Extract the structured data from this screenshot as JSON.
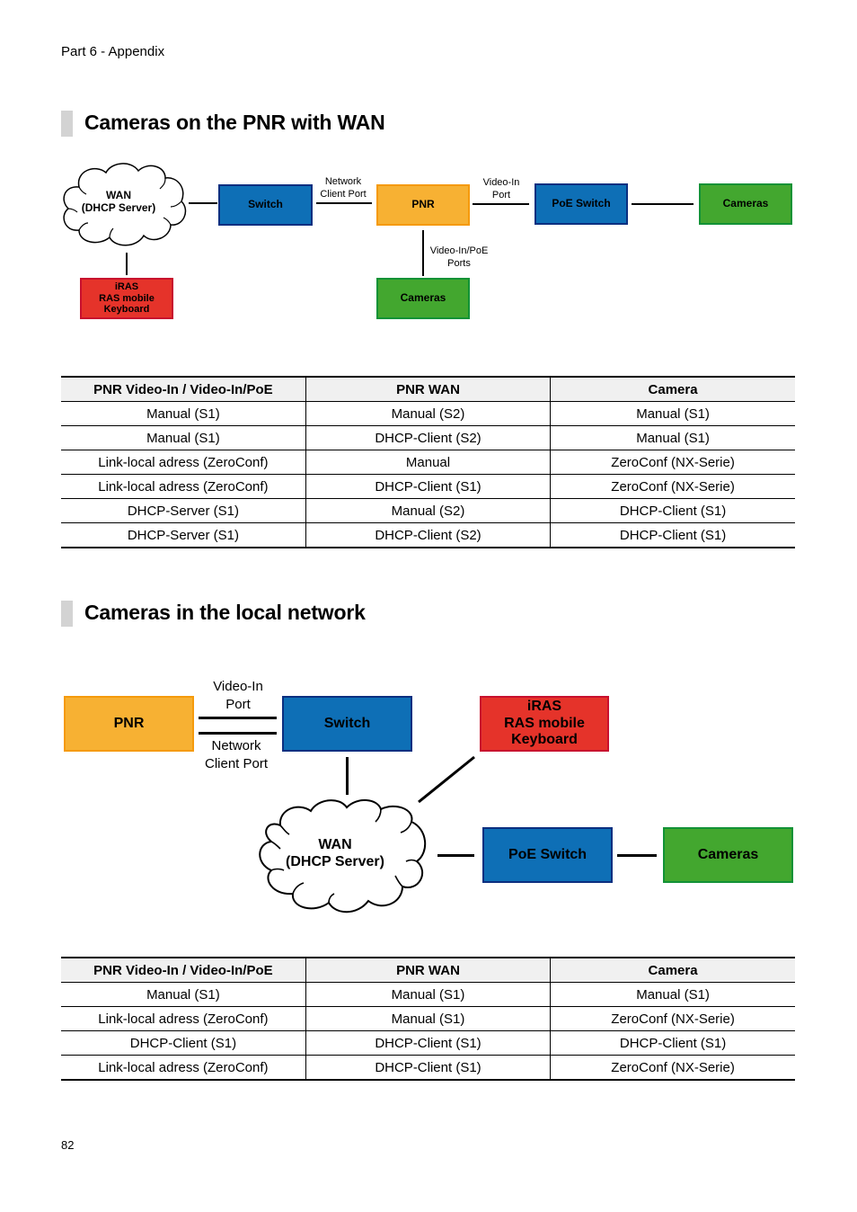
{
  "page": {
    "header": "Part 6 - Appendix",
    "page_number": "82"
  },
  "section1": {
    "title": "Cameras on the PNR with WAN",
    "diagram": {
      "wan_cloud": "WAN\n(DHCP Server)",
      "switch": "Switch",
      "pnr": "PNR",
      "poe_switch": "PoE Switch",
      "cameras_right": "Cameras",
      "cameras_bottom": "Cameras",
      "keyboard": "iRAS\nRAS mobile\nKeyboard",
      "label_network_client_port": "Network\nClient Port",
      "label_video_in_port": "Video-In\nPort",
      "label_video_in_poe_ports": "Video-In/PoE\nPorts"
    },
    "table": {
      "headers": [
        "PNR  Video-In / Video-In/PoE",
        "PNR WAN",
        "Camera"
      ],
      "rows": [
        [
          "Manual (S1)",
          "Manual (S2)",
          "Manual (S1)"
        ],
        [
          "Manual (S1)",
          "DHCP-Client (S2)",
          "Manual (S1)"
        ],
        [
          "Link-local adress (ZeroConf)",
          "Manual",
          "ZeroConf (NX-Serie)"
        ],
        [
          "Link-local adress (ZeroConf)",
          "DHCP-Client (S1)",
          "ZeroConf (NX-Serie)"
        ],
        [
          "DHCP-Server (S1)",
          "Manual (S2)",
          "DHCP-Client (S1)"
        ],
        [
          "DHCP-Server (S1)",
          "DHCP-Client (S2)",
          "DHCP-Client (S1)"
        ]
      ]
    }
  },
  "section2": {
    "title": "Cameras in the local network",
    "diagram": {
      "pnr": "PNR",
      "switch": "Switch",
      "keyboard": "iRAS\nRAS mobile\nKeyboard",
      "wan_cloud": "WAN\n(DHCP Server)",
      "poe_switch": "PoE Switch",
      "cameras": "Cameras",
      "label_video_in_port": "Video-In\nPort",
      "label_network_client_port": "Network\nClient Port"
    },
    "table": {
      "headers": [
        "PNR  Video-In / Video-In/PoE",
        "PNR WAN",
        "Camera"
      ],
      "rows": [
        [
          "Manual (S1)",
          "Manual (S1)",
          "Manual (S1)"
        ],
        [
          "Link-local adress (ZeroConf)",
          "Manual (S1)",
          "ZeroConf (NX-Serie)"
        ],
        [
          "DHCP-Client (S1)",
          "DHCP-Client (S1)",
          "DHCP-Client (S1)"
        ],
        [
          "Link-local adress (ZeroConf)",
          "DHCP-Client (S1)",
          "ZeroConf (NX-Serie)"
        ]
      ]
    }
  },
  "colors": {
    "switch_blue": "#0e6fb6",
    "pnr_orange": "#f7b133",
    "cameras_green": "#43a72f",
    "keyboard_red": "#e5332a",
    "section_bar_gray": "#d3d3d3",
    "table_header_bg": "#f0f0f0"
  }
}
